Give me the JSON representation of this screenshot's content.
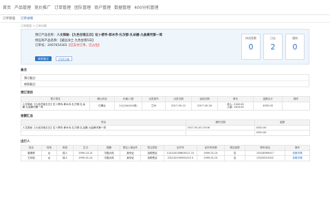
{
  "nav": [
    "首页",
    "产品管理",
    "竞价推广",
    "订单管理",
    "团队管理",
    "商户管理",
    "数据管理",
    "400分机管理"
  ],
  "tabs": [
    "订单管理",
    "订单详情"
  ],
  "breadcrumb": "订单管理 > 订单详情",
  "order": {
    "product_label": "预订产品名称：",
    "product_name": "人文探秘-【九色甘南五日】拉卜楞寺-郎木寺-扎尕那-扎朵栅-九曲黄河第一湾",
    "supplier": "供应商产品名称：【遨远净土 九色甘南5日】",
    "order_no": "订单号：2007654365",
    "status": "【已支付订单，已占位】",
    "btn_remark": "商家备注",
    "btn_print": "打印订单"
  },
  "stats": [
    {
      "label": "待消息数",
      "value": "0"
    },
    {
      "label": "日志",
      "value": "2"
    },
    {
      "label": "通知",
      "value": "0"
    }
  ],
  "remarks": {
    "title": "备注",
    "rows": [
      "预订备注：",
      "商家备注："
    ]
  },
  "trip": {
    "title": "预订项目",
    "headers": [
      "预订项目",
      "确认状态",
      "价格/人数",
      "出发城市",
      "出发日期",
      "返回日期",
      "单价",
      "金额合计",
      "操作"
    ],
    "row": [
      "人文探秘-【九色甘南五日】拉卜楞寺-郎木寺-扎尕那-扎朵栅-九曲黄河第一湾",
      "已确认",
      "2人(2大0小0老)",
      "兰州",
      "2017-05-12",
      "2017-05-16",
      "成人: 2160.00\n儿童: 1300.00",
      "4320.00",
      ""
    ]
  },
  "amount": {
    "title": "金额汇总",
    "headers": [
      "项目",
      "操作日期",
      "金额"
    ],
    "row": [
      "人文探秘-【九色甘南五日】拉卜楞寺-郎木寺-扎尕那-扎朵栅-九曲黄河第一湾",
      "2017-05-03 15:08",
      "4320.00"
    ],
    "total": "4320.00"
  },
  "travelers": {
    "title": "出行人",
    "headers": [
      "姓名",
      "性别",
      "类型",
      "生日",
      "国籍",
      "是否入境证件",
      "签注类型",
      "证件号",
      "证件有效期",
      "是否面签",
      "联系电话",
      "操作"
    ],
    "rows": [
      [
        "曾德林",
        "女",
        "成人",
        "1999-10-21",
        "中国大陆",
        "身份证",
        "自助签证",
        "110105199809211 22",
        "1999-01-01",
        "否",
        "15018999917",
        "查看详情"
      ],
      [
        "王欣怡",
        "女",
        "成人",
        "1999-01-01",
        "中国大陆",
        "身份证",
        "自助签证",
        "232102199901010 5",
        "1999-01-01",
        "否",
        "13520019322",
        "查看详情"
      ]
    ]
  }
}
